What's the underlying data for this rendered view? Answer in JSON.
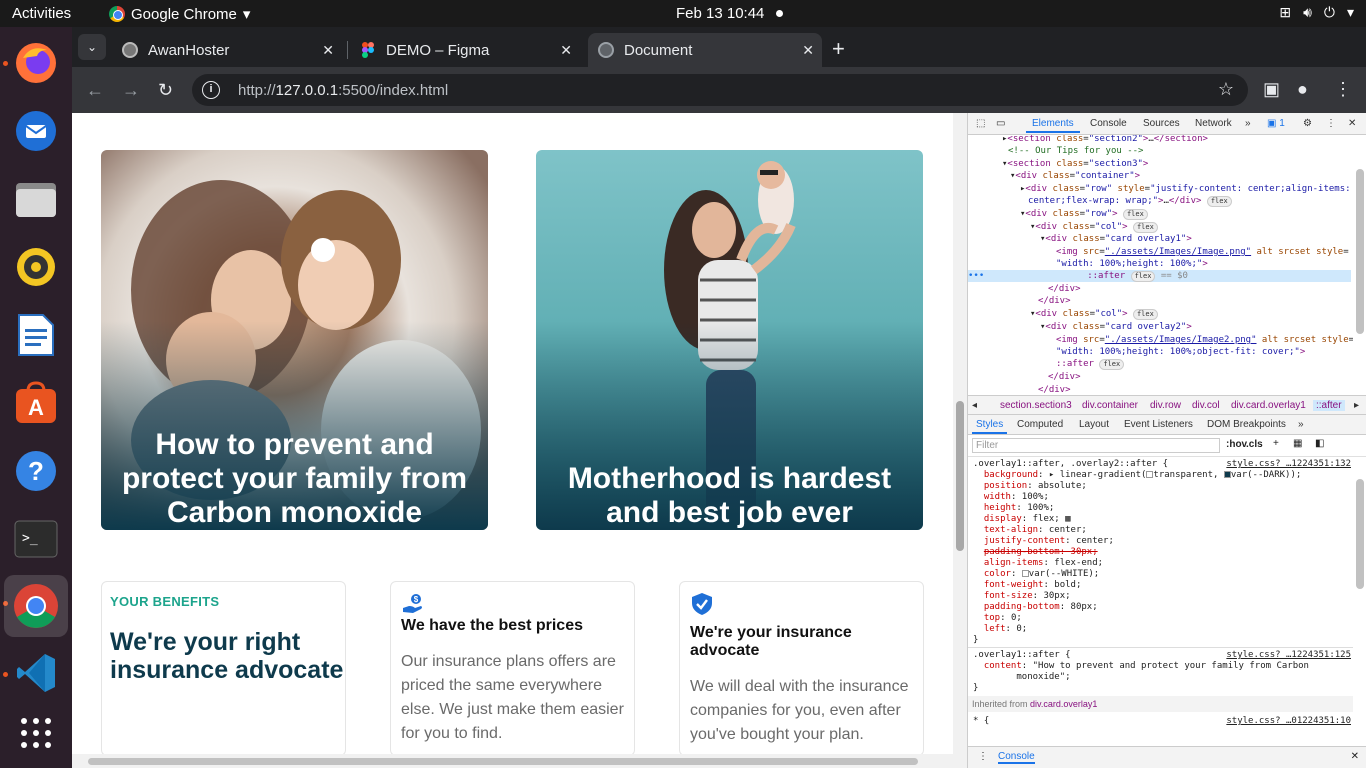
{
  "system": {
    "activities": "Activities",
    "app_name": "Google Chrome",
    "clock": "Feb 13  10:44"
  },
  "browser": {
    "tabs": [
      {
        "title": "AwanHoster",
        "active": false
      },
      {
        "title": "DEMO – Figma",
        "active": false
      },
      {
        "title": "Document",
        "active": true
      }
    ],
    "url_scheme": "http://",
    "url_host": "127.0.0.1",
    "url_rest": ":5500/index.html"
  },
  "page": {
    "card1_text": "How to prevent and protect your family from Carbon monoxide",
    "card2_text": "Motherhood is hardest and best job ever",
    "benefits_tag": "YOUR BENEFITS",
    "benefits_title": "We're your right insurance advocate",
    "price_title": "We have the best prices",
    "price_body": "Our insurance plans offers are priced the same everywhere else. We just make them easier for you to find.",
    "advocate_title": "We're your insurance advocate",
    "advocate_body": "We will deal with the insurance companies for you, even after you've bought your plan."
  },
  "devtools": {
    "tabs": [
      "Elements",
      "Console",
      "Sources",
      "Network"
    ],
    "issues_count": "1",
    "breadcrumb": [
      "section.section3",
      "div.container",
      "div.row",
      "div.col",
      "div.card.overlay1",
      "::after"
    ],
    "subtabs": [
      "Styles",
      "Computed",
      "Layout",
      "Event Listeners",
      "DOM Breakpoints"
    ],
    "filter_placeholder": "Filter",
    "hov": ":hov",
    "cls": ".cls",
    "rule1_selector": ".overlay1::after, .overlay2::after {",
    "rule1_source": "style.css? …1224351:132",
    "rule2_selector": ".overlay1::after {",
    "rule2_source": "style.css? …1224351:125",
    "rule2_content": "\"How to prevent and protect your family from Carbon",
    "rule2_content_2": "monoxide\";",
    "inherited_label": "Inherited from",
    "inherited_from": "div.card.overlay1",
    "rule3_source": "style.css? …01224351:10",
    "console_label": "Console"
  },
  "colors": {
    "accent_teal": "#1ca48c",
    "dark_navy": "#0e3a4c",
    "devtools_blue": "#1a73e8"
  }
}
